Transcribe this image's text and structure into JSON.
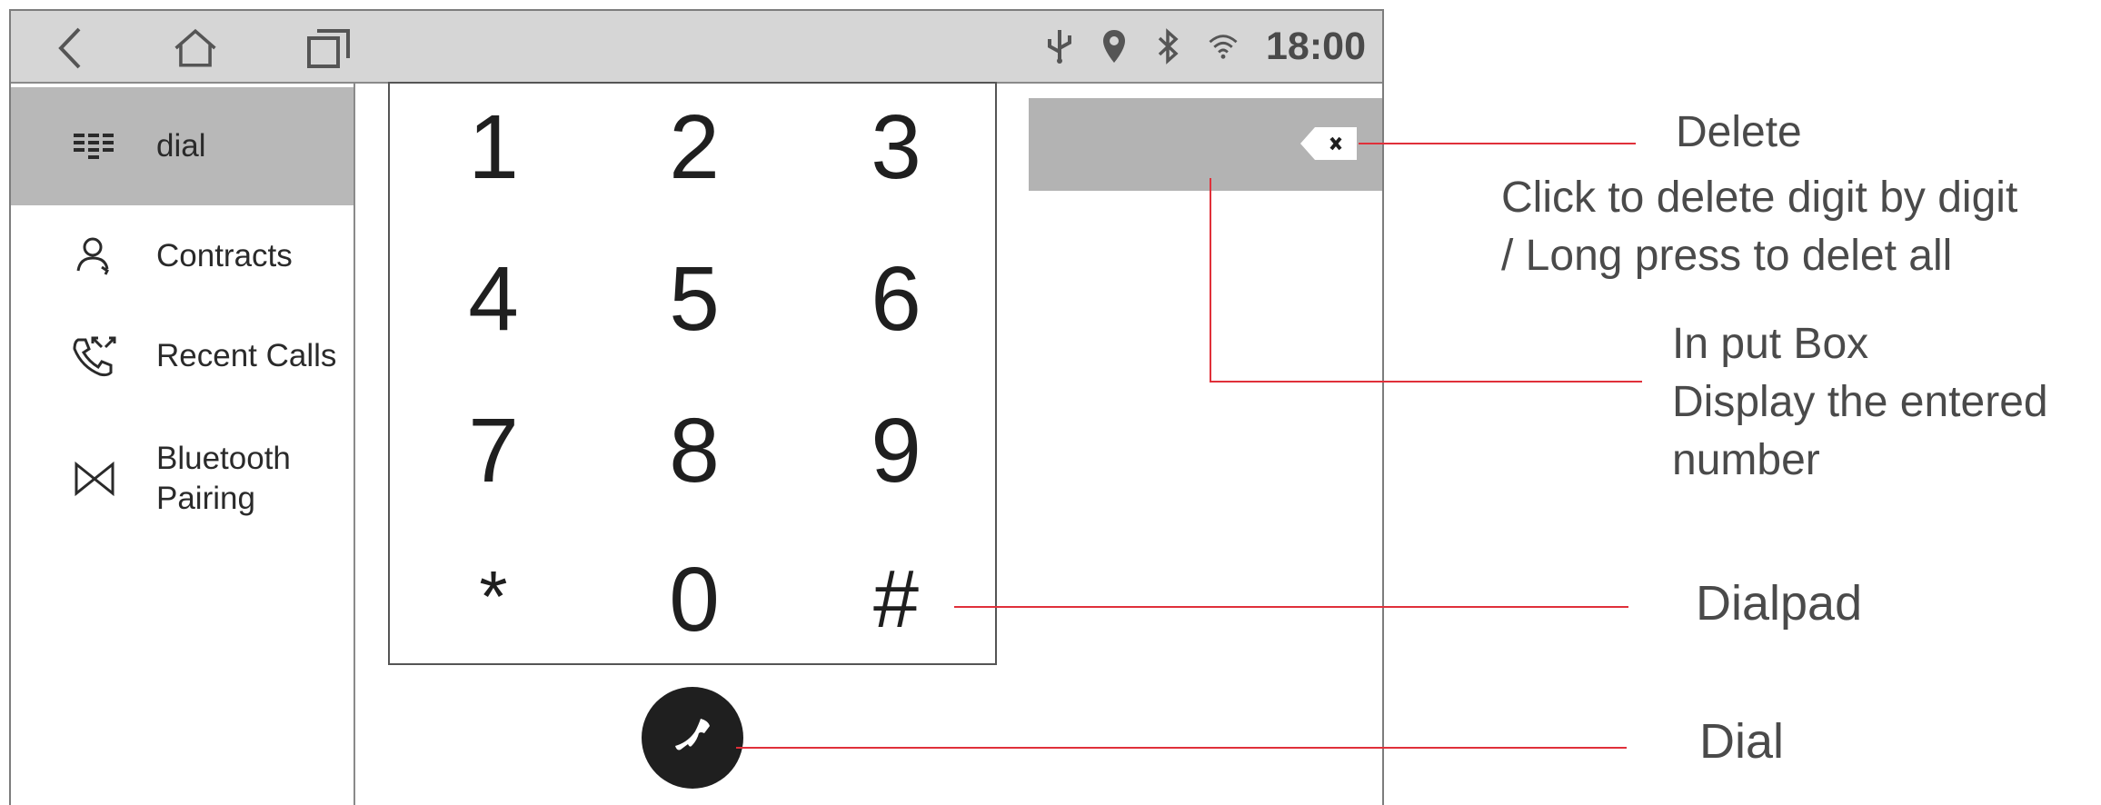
{
  "status_bar": {
    "nav_icons": [
      "back-icon",
      "home-icon",
      "recent-apps-icon"
    ],
    "status_icons": [
      "usb-icon",
      "location-icon",
      "bluetooth-icon",
      "wifi-icon"
    ],
    "clock": "18:00"
  },
  "sidebar": {
    "items": [
      {
        "label": "dial",
        "icon": "dialpad-icon",
        "active": true
      },
      {
        "label": "Contracts",
        "icon": "person-icon",
        "active": false
      },
      {
        "label": "Recent Calls",
        "icon": "recent-calls-icon",
        "active": false
      },
      {
        "label": "Bluetooth\nPairing",
        "icon": "bluetooth-pairing-icon",
        "active": false
      }
    ]
  },
  "dialpad": {
    "keys": [
      "1",
      "2",
      "3",
      "4",
      "5",
      "6",
      "7",
      "8",
      "9",
      "*",
      "0",
      "#"
    ]
  },
  "input_box": {
    "value": "",
    "delete_icon": "backspace-icon"
  },
  "call_button": {
    "icon": "phone-icon"
  },
  "colors": {
    "status_bar_bg": "#d6d6d6",
    "sidebar_active_bg": "#b8b8b8",
    "input_box_bg": "#b3b3b3",
    "call_button_bg": "#1f1f1f",
    "annotation_line": "#e0303a"
  },
  "annotations": {
    "delete": {
      "title": "Delete",
      "line1": "Click to delete digit by digit",
      "line2": "/ Long press to delet all"
    },
    "input_box": {
      "line1": "In put Box",
      "line2": "Display the entered",
      "line3": "number"
    },
    "dialpad": {
      "title": "Dialpad"
    },
    "dial": {
      "title": "Dial"
    }
  }
}
